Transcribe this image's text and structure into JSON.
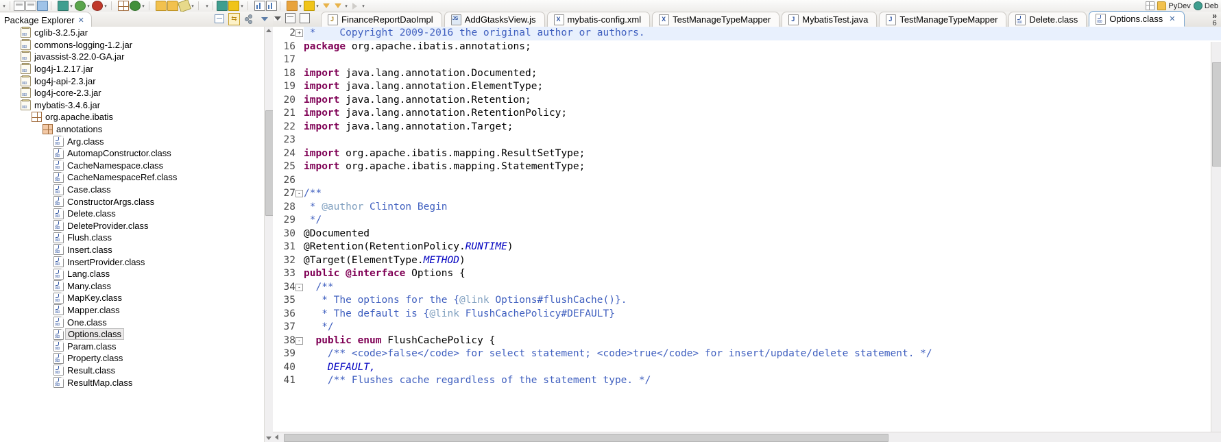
{
  "window": {
    "perspective_bar": [
      {
        "label": "PyDev",
        "icon": "pydev-perspective-icon"
      },
      {
        "label": "Deb",
        "icon": "debug-perspective-icon"
      }
    ],
    "open_perspective_icon": "open-perspective-icon"
  },
  "toolbar": {
    "groups": [
      {
        "items": [
          {
            "name": "new-wizard-dropdown-arrow",
            "icon": "chevron-down-icon"
          },
          {
            "name": "save-button",
            "icon": "save-icon"
          },
          {
            "name": "save-all-button",
            "icon": "save-all-icon"
          },
          {
            "name": "print-button",
            "icon": "print-icon"
          }
        ]
      },
      {
        "items": [
          {
            "name": "debug-button",
            "icon": "debug-bug-icon"
          },
          {
            "name": "debug-dropdown-arrow",
            "icon": "chevron-down-icon"
          },
          {
            "name": "run-button",
            "icon": "run-green-icon"
          },
          {
            "name": "run-dropdown-arrow",
            "icon": "chevron-down-icon"
          },
          {
            "name": "run-external-tools-button",
            "icon": "external-tools-icon"
          },
          {
            "name": "external-tools-dropdown-arrow",
            "icon": "chevron-down-icon"
          }
        ]
      },
      {
        "items": [
          {
            "name": "new-java-package-button",
            "icon": "package-grid-icon"
          },
          {
            "name": "refresh-button",
            "icon": "refresh-icon"
          },
          {
            "name": "refresh-dropdown-arrow",
            "icon": "chevron-down-icon"
          }
        ]
      },
      {
        "items": [
          {
            "name": "open-type-button",
            "icon": "open-folder-icon"
          },
          {
            "name": "open-task-button",
            "icon": "open-folder-icon"
          },
          {
            "name": "edit-button",
            "icon": "pencil-icon"
          },
          {
            "name": "edit-dropdown-arrow",
            "icon": "chevron-down-icon"
          }
        ]
      },
      {
        "items": [
          {
            "name": "search-button",
            "icon": "search-icon"
          },
          {
            "name": "link-button",
            "icon": "link-icon"
          },
          {
            "name": "link-dropdown-arrow",
            "icon": "chevron-down-icon"
          }
        ]
      },
      {
        "items": [
          {
            "name": "outline-button",
            "icon": "outline-list-icon"
          },
          {
            "name": "chart-button",
            "icon": "bar-chart-icon"
          }
        ]
      },
      {
        "items": [
          {
            "name": "toggle-markers-button",
            "icon": "marker-icon"
          },
          {
            "name": "markers-dropdown-arrow",
            "icon": "chevron-down-icon"
          },
          {
            "name": "next-annotation-button",
            "icon": "next-annotation-icon"
          },
          {
            "name": "next-dropdown-arrow",
            "icon": "chevron-down-icon"
          },
          {
            "name": "back-button",
            "icon": "back-arrow-icon"
          },
          {
            "name": "forward-button",
            "icon": "forward-arrow-icon"
          },
          {
            "name": "forward-dropdown-arrow",
            "icon": "chevron-down-icon"
          },
          {
            "name": "nav-last-button",
            "icon": "nav-last-icon"
          },
          {
            "name": "nav-dropdown-arrow",
            "icon": "chevron-down-icon"
          }
        ]
      }
    ]
  },
  "package_explorer": {
    "tab_label": "Package Explorer",
    "tab_close_icon": "close-icon",
    "tools": [
      {
        "name": "collapse-all-button",
        "icon": "collapse-all-icon"
      },
      {
        "name": "link-with-editor-button",
        "icon": "link-with-editor-icon"
      },
      {
        "name": "view-filters-button",
        "icon": "filters-icon"
      },
      {
        "name": "view-menu-button",
        "icon": "view-menu-icon"
      }
    ],
    "tree": [
      {
        "label": "cglib-3.2.5.jar",
        "icon": "jar-icon",
        "indent": 1,
        "type": "jar",
        "selected": false
      },
      {
        "label": "commons-logging-1.2.jar",
        "icon": "jar-icon",
        "indent": 1,
        "type": "jar",
        "selected": false
      },
      {
        "label": "javassist-3.22.0-GA.jar",
        "icon": "jar-icon",
        "indent": 1,
        "type": "jar",
        "selected": false
      },
      {
        "label": "log4j-1.2.17.jar",
        "icon": "jar-icon",
        "indent": 1,
        "type": "jar",
        "selected": false
      },
      {
        "label": "log4j-api-2.3.jar",
        "icon": "jar-icon",
        "indent": 1,
        "type": "jar",
        "selected": false
      },
      {
        "label": "log4j-core-2.3.jar",
        "icon": "jar-icon",
        "indent": 1,
        "type": "jar",
        "selected": false
      },
      {
        "label": "mybatis-3.4.6.jar",
        "icon": "jar-open-icon",
        "indent": 1,
        "type": "jar",
        "selected": false
      },
      {
        "label": "org.apache.ibatis",
        "icon": "package-icon",
        "indent": 2,
        "type": "package",
        "selected": false
      },
      {
        "label": "annotations",
        "icon": "package-current-icon",
        "indent": 3,
        "type": "package-cur",
        "selected": false
      },
      {
        "label": "Arg.class",
        "icon": "class-file-icon",
        "indent": 4,
        "type": "class",
        "selected": false
      },
      {
        "label": "AutomapConstructor.class",
        "icon": "class-file-icon",
        "indent": 4,
        "type": "class",
        "selected": false
      },
      {
        "label": "CacheNamespace.class",
        "icon": "class-file-icon",
        "indent": 4,
        "type": "class",
        "selected": false
      },
      {
        "label": "CacheNamespaceRef.class",
        "icon": "class-file-icon",
        "indent": 4,
        "type": "class",
        "selected": false
      },
      {
        "label": "Case.class",
        "icon": "class-file-icon",
        "indent": 4,
        "type": "class",
        "selected": false
      },
      {
        "label": "ConstructorArgs.class",
        "icon": "class-file-icon",
        "indent": 4,
        "type": "class",
        "selected": false
      },
      {
        "label": "Delete.class",
        "icon": "class-file-icon",
        "indent": 4,
        "type": "class",
        "selected": false
      },
      {
        "label": "DeleteProvider.class",
        "icon": "class-file-icon",
        "indent": 4,
        "type": "class",
        "selected": false
      },
      {
        "label": "Flush.class",
        "icon": "class-file-icon",
        "indent": 4,
        "type": "class",
        "selected": false
      },
      {
        "label": "Insert.class",
        "icon": "class-file-icon",
        "indent": 4,
        "type": "class",
        "selected": false
      },
      {
        "label": "InsertProvider.class",
        "icon": "class-file-icon",
        "indent": 4,
        "type": "class",
        "selected": false
      },
      {
        "label": "Lang.class",
        "icon": "class-file-icon",
        "indent": 4,
        "type": "class",
        "selected": false
      },
      {
        "label": "Many.class",
        "icon": "class-file-icon",
        "indent": 4,
        "type": "class",
        "selected": false
      },
      {
        "label": "MapKey.class",
        "icon": "class-file-icon",
        "indent": 4,
        "type": "class",
        "selected": false
      },
      {
        "label": "Mapper.class",
        "icon": "class-file-icon",
        "indent": 4,
        "type": "class",
        "selected": false
      },
      {
        "label": "One.class",
        "icon": "class-file-icon",
        "indent": 4,
        "type": "class",
        "selected": false
      },
      {
        "label": "Options.class",
        "icon": "class-file-icon",
        "indent": 4,
        "type": "class",
        "selected": true
      },
      {
        "label": "Param.class",
        "icon": "class-file-icon",
        "indent": 4,
        "type": "class",
        "selected": false
      },
      {
        "label": "Property.class",
        "icon": "class-file-icon",
        "indent": 4,
        "type": "class",
        "selected": false
      },
      {
        "label": "Result.class",
        "icon": "class-file-icon",
        "indent": 4,
        "type": "class",
        "selected": false
      },
      {
        "label": "ResultMap.class",
        "icon": "class-file-icon",
        "indent": 4,
        "type": "class",
        "selected": false
      }
    ]
  },
  "editor_area": {
    "minimize_icon": "minimize-icon",
    "maximize_icon": "maximize-icon",
    "view_menu_icon": "chevron-down-icon",
    "overflow_chevrons": "»",
    "overflow_count": "6",
    "tabs": [
      {
        "label": "FinanceReportDaoImpl",
        "icon": "java-file-icon",
        "kind": "dao",
        "active": false
      },
      {
        "label": "AddGtasksView.js",
        "icon": "js-file-icon",
        "kind": "js",
        "active": false
      },
      {
        "label": "mybatis-config.xml",
        "icon": "xml-file-icon",
        "kind": "x",
        "active": false
      },
      {
        "label": "TestManageTypeMapper",
        "icon": "xml-file-icon",
        "kind": "x",
        "active": false
      },
      {
        "label": "MybatisTest.java",
        "icon": "java-file-icon",
        "kind": "j",
        "active": false
      },
      {
        "label": "TestManageTypeMapper",
        "icon": "java-file-icon",
        "kind": "j",
        "active": false
      },
      {
        "label": "Delete.class",
        "icon": "class-file-icon",
        "kind": "cls",
        "active": false
      },
      {
        "label": "Options.class",
        "icon": "class-file-icon",
        "kind": "cls",
        "active": true,
        "close_icon": "close-icon"
      }
    ]
  },
  "code": {
    "lines": [
      {
        "num": "2",
        "fold": "+",
        "highlight": true,
        "segments": [
          {
            "t": " * ",
            "c": "cmt"
          },
          {
            "t": "   Copyright 2009-2016 the original author or authors.",
            "c": "cmt"
          }
        ]
      },
      {
        "num": "16",
        "fold": "",
        "highlight": false,
        "segments": [
          {
            "t": "package ",
            "c": "kw"
          },
          {
            "t": "org.apache.ibatis.annotations;",
            "c": ""
          }
        ]
      },
      {
        "num": "17",
        "fold": "",
        "highlight": false,
        "segments": [
          {
            "t": "",
            "c": ""
          }
        ]
      },
      {
        "num": "18",
        "fold": "",
        "highlight": false,
        "segments": [
          {
            "t": "import ",
            "c": "kw"
          },
          {
            "t": "java.lang.annotation.Documented;",
            "c": ""
          }
        ]
      },
      {
        "num": "19",
        "fold": "",
        "highlight": false,
        "segments": [
          {
            "t": "import ",
            "c": "kw"
          },
          {
            "t": "java.lang.annotation.ElementType;",
            "c": ""
          }
        ]
      },
      {
        "num": "20",
        "fold": "",
        "highlight": false,
        "segments": [
          {
            "t": "import ",
            "c": "kw"
          },
          {
            "t": "java.lang.annotation.Retention;",
            "c": ""
          }
        ]
      },
      {
        "num": "21",
        "fold": "",
        "highlight": false,
        "segments": [
          {
            "t": "import ",
            "c": "kw"
          },
          {
            "t": "java.lang.annotation.RetentionPolicy;",
            "c": ""
          }
        ]
      },
      {
        "num": "22",
        "fold": "",
        "highlight": false,
        "segments": [
          {
            "t": "import ",
            "c": "kw"
          },
          {
            "t": "java.lang.annotation.Target;",
            "c": ""
          }
        ]
      },
      {
        "num": "23",
        "fold": "",
        "highlight": false,
        "segments": [
          {
            "t": "",
            "c": ""
          }
        ]
      },
      {
        "num": "24",
        "fold": "",
        "highlight": false,
        "segments": [
          {
            "t": "import ",
            "c": "kw"
          },
          {
            "t": "org.apache.ibatis.mapping.ResultSetType;",
            "c": ""
          }
        ]
      },
      {
        "num": "25",
        "fold": "",
        "highlight": false,
        "segments": [
          {
            "t": "import ",
            "c": "kw"
          },
          {
            "t": "org.apache.ibatis.mapping.StatementType;",
            "c": ""
          }
        ]
      },
      {
        "num": "26",
        "fold": "",
        "highlight": false,
        "segments": [
          {
            "t": "",
            "c": ""
          }
        ]
      },
      {
        "num": "27",
        "fold": "-",
        "highlight": false,
        "segments": [
          {
            "t": "/**",
            "c": "jdoc"
          }
        ]
      },
      {
        "num": "28",
        "fold": "",
        "highlight": false,
        "segments": [
          {
            "t": " * ",
            "c": "jdoc"
          },
          {
            "t": "@author",
            "c": "jtag"
          },
          {
            "t": " Clinton Begin",
            "c": "jdoc"
          }
        ]
      },
      {
        "num": "29",
        "fold": "",
        "highlight": false,
        "segments": [
          {
            "t": " */",
            "c": "jdoc"
          }
        ]
      },
      {
        "num": "30",
        "fold": "",
        "highlight": false,
        "segments": [
          {
            "t": "@Documented",
            "c": ""
          }
        ]
      },
      {
        "num": "31",
        "fold": "",
        "highlight": false,
        "segments": [
          {
            "t": "@Retention(RetentionPolicy.",
            "c": ""
          },
          {
            "t": "RUNTIME",
            "c": "stc"
          },
          {
            "t": ")",
            "c": ""
          }
        ]
      },
      {
        "num": "32",
        "fold": "",
        "highlight": false,
        "segments": [
          {
            "t": "@Target(ElementType.",
            "c": ""
          },
          {
            "t": "METHOD",
            "c": "stc"
          },
          {
            "t": ")",
            "c": ""
          }
        ]
      },
      {
        "num": "33",
        "fold": "",
        "highlight": false,
        "segments": [
          {
            "t": "public @interface ",
            "c": "kw"
          },
          {
            "t": "Options {",
            "c": ""
          }
        ]
      },
      {
        "num": "34",
        "fold": "-",
        "highlight": false,
        "segments": [
          {
            "t": "  /**",
            "c": "jdoc"
          }
        ]
      },
      {
        "num": "35",
        "fold": "",
        "highlight": false,
        "segments": [
          {
            "t": "   * The options for the {",
            "c": "jdoc"
          },
          {
            "t": "@link",
            "c": "jtag"
          },
          {
            "t": " Options#flushCache()}.",
            "c": "jdoc"
          }
        ]
      },
      {
        "num": "36",
        "fold": "",
        "highlight": false,
        "segments": [
          {
            "t": "   * The default is {",
            "c": "jdoc"
          },
          {
            "t": "@link",
            "c": "jtag"
          },
          {
            "t": " FlushCachePolicy#DEFAULT}",
            "c": "jdoc"
          }
        ]
      },
      {
        "num": "37",
        "fold": "",
        "highlight": false,
        "segments": [
          {
            "t": "   */",
            "c": "jdoc"
          }
        ]
      },
      {
        "num": "38",
        "fold": "-",
        "highlight": false,
        "segments": [
          {
            "t": "  public enum ",
            "c": "kw"
          },
          {
            "t": "FlushCachePolicy {",
            "c": ""
          }
        ]
      },
      {
        "num": "39",
        "fold": "",
        "highlight": false,
        "segments": [
          {
            "t": "    /** <code>false</code> for select statement; <code>true</code> for insert/update/delete statement. */",
            "c": "jdoc"
          }
        ]
      },
      {
        "num": "40",
        "fold": "",
        "highlight": false,
        "segments": [
          {
            "t": "    DEFAULT,",
            "c": "stc"
          }
        ]
      },
      {
        "num": "41",
        "fold": "",
        "highlight": false,
        "segments": [
          {
            "t": "    /** Flushes cache regardless of the statement type. */",
            "c": "jdoc"
          }
        ]
      }
    ]
  },
  "colors": {
    "keyword": "#7f0055",
    "javadoc": "#3f5fbf",
    "javadoc_tag": "#7f9fbf",
    "static_field": "#0000c0",
    "active_tab_border": "#7aa6d0",
    "highlight_row": "#e8f0fd"
  }
}
